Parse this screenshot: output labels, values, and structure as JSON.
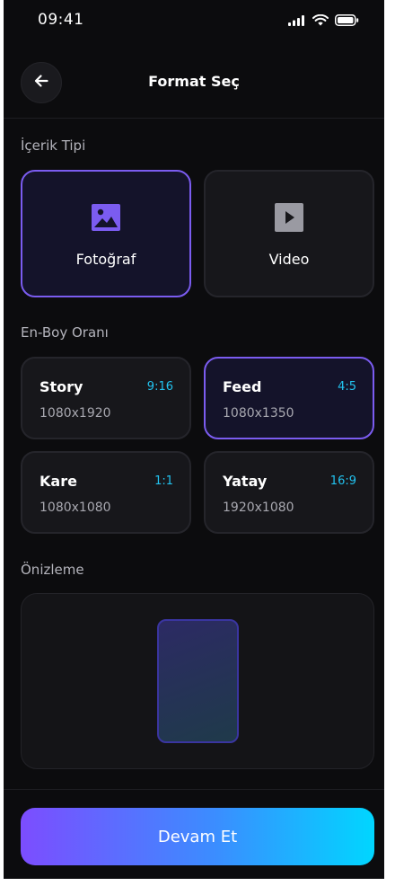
{
  "status": {
    "time": "09:41"
  },
  "header": {
    "title": "Format Seç",
    "back_icon": "arrow-left-icon"
  },
  "content_type": {
    "label": "İçerik Tipi",
    "options": [
      {
        "label": "Fotoğraf",
        "icon": "image-icon",
        "selected": true
      },
      {
        "label": "Video",
        "icon": "play-icon",
        "selected": false
      }
    ]
  },
  "aspect_ratio": {
    "label": "En-Boy Oranı",
    "options": [
      {
        "name": "Story",
        "ratio": "9:16",
        "dims": "1080x1920",
        "selected": false
      },
      {
        "name": "Feed",
        "ratio": "4:5",
        "dims": "1080x1350",
        "selected": true
      },
      {
        "name": "Kare",
        "ratio": "1:1",
        "dims": "1080x1080",
        "selected": false
      },
      {
        "name": "Yatay",
        "ratio": "16:9",
        "dims": "1920x1080",
        "selected": false
      }
    ]
  },
  "preview": {
    "label": "Önizleme"
  },
  "footer": {
    "continue_label": "Devam Et"
  },
  "colors": {
    "accent": "#7b5cf0",
    "ratio_text": "#22c3f0",
    "background": "#0c0c0e"
  }
}
